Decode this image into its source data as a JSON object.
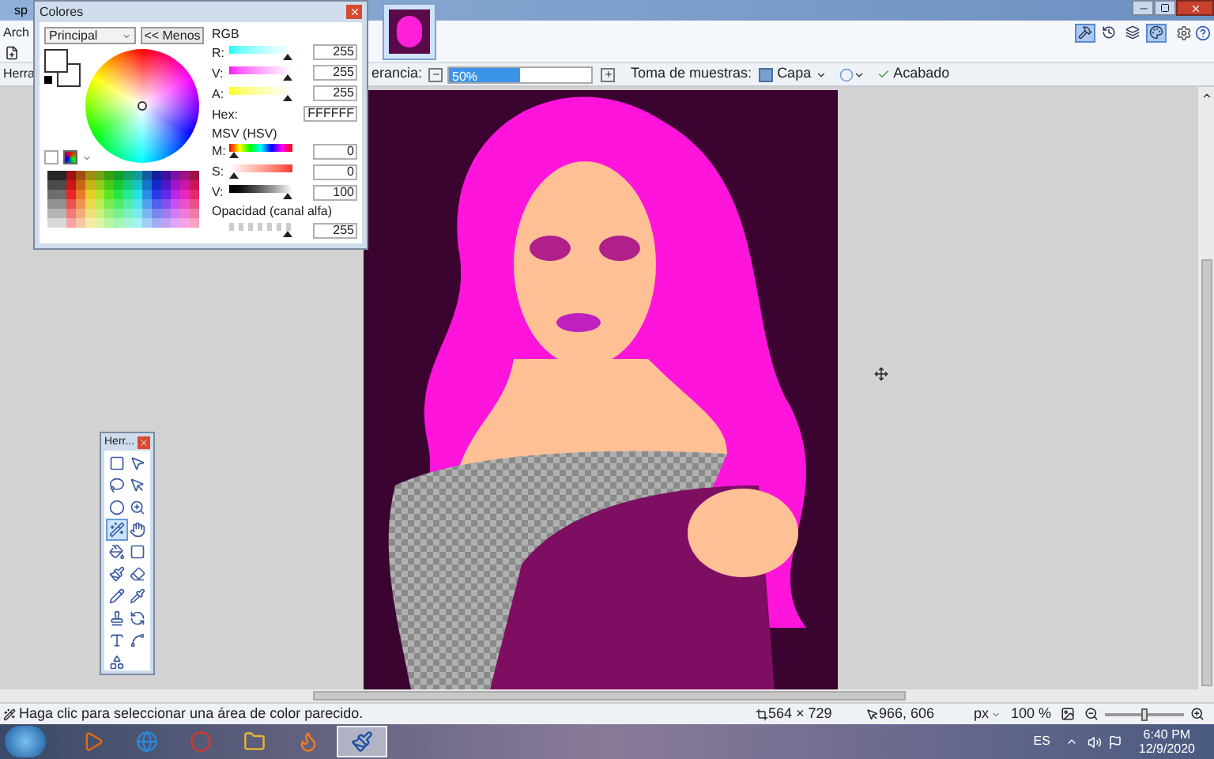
{
  "app_window": {
    "title": "sp",
    "menu_items": [
      {
        "label": "Arch"
      }
    ],
    "image_tabs": [
      {
        "selected": true
      }
    ],
    "panel_toggles": [
      {
        "kind": "tools",
        "on": true
      },
      {
        "kind": "history",
        "on": false
      },
      {
        "kind": "layers",
        "on": false
      },
      {
        "kind": "colors",
        "on": true
      }
    ]
  },
  "tool_options": {
    "tool_label": "Herra",
    "tolerance_label": "erancia:",
    "tolerance": {
      "text": "50%",
      "level": 0.5
    },
    "sampling_label": "Toma de muestras:",
    "sampling_value": "Capa",
    "finish_label": "Acabado"
  },
  "colors_window": {
    "title": "Colores",
    "palette_select": "Principal",
    "less_button": "<< Menos",
    "rgb_heading": "RGB",
    "rgb_rows": [
      {
        "label": "R:",
        "value": "255",
        "level": 1,
        "kind": "red"
      },
      {
        "label": "V:",
        "value": "255",
        "level": 1,
        "kind": "green"
      },
      {
        "label": "A:",
        "value": "255",
        "level": 1,
        "kind": "blue"
      }
    ],
    "hex_label": "Hex:",
    "hex_value": "FFFFFF",
    "hsv_heading": "MSV (HSV)",
    "hsv_rows": [
      {
        "label": "M:",
        "value": "0",
        "level": 0,
        "kind": "hue"
      },
      {
        "label": "S:",
        "value": "0",
        "level": 0,
        "kind": "saturation"
      },
      {
        "label": "V:",
        "value": "100",
        "level": 1,
        "kind": "value"
      }
    ],
    "alpha_heading": "Opacidad (canal alfa)",
    "alpha": {
      "value": "255",
      "level": 1
    }
  },
  "tools_window": {
    "title": "Herr...",
    "tools": [
      {
        "kind": "rect-select",
        "selected": false
      },
      {
        "kind": "move-selected",
        "selected": false
      },
      {
        "kind": "lasso",
        "selected": false
      },
      {
        "kind": "move-selection",
        "selected": false
      },
      {
        "kind": "ellipse-select",
        "selected": false
      },
      {
        "kind": "zoom",
        "selected": false
      },
      {
        "kind": "magic-wand",
        "selected": true
      },
      {
        "kind": "pan",
        "selected": false
      },
      {
        "kind": "bucket",
        "selected": false
      },
      {
        "kind": "gradient",
        "selected": false
      },
      {
        "kind": "brush",
        "selected": false
      },
      {
        "kind": "eraser",
        "selected": false
      },
      {
        "kind": "pencil",
        "selected": false
      },
      {
        "kind": "picker",
        "selected": false
      },
      {
        "kind": "stamp",
        "selected": false
      },
      {
        "kind": "recolor",
        "selected": false
      },
      {
        "kind": "text",
        "selected": false
      },
      {
        "kind": "line",
        "selected": false
      },
      {
        "kind": "shapes",
        "selected": false
      }
    ]
  },
  "status_bar": {
    "hint": "Haga clic para seleccionar una área de color parecido.",
    "image_size": "564 × 729",
    "cursor_position": "966, 606",
    "unit": "px",
    "zoom": "100 %",
    "zoom_slider": {
      "level": 0.5
    }
  },
  "taskbar": {
    "apps": [
      {
        "kind": "media",
        "selected": false
      },
      {
        "kind": "ie",
        "selected": false
      },
      {
        "kind": "chrome",
        "selected": false
      },
      {
        "kind": "folder",
        "selected": false
      },
      {
        "kind": "firefox",
        "selected": false
      },
      {
        "kind": "paint",
        "selected": true
      }
    ],
    "language": "ES",
    "time": "6:40 PM",
    "date": "12/9/2020"
  }
}
